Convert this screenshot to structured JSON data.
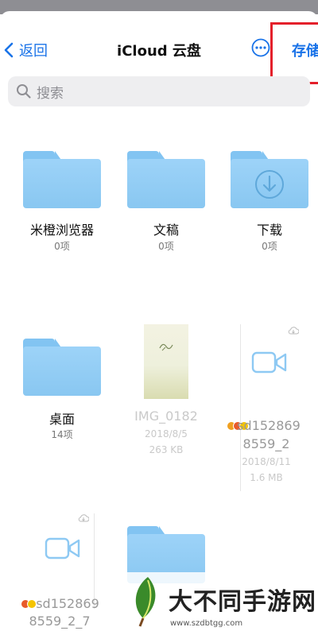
{
  "nav": {
    "back_label": "返回",
    "title": "iCloud 云盘",
    "more_icon": "ellipsis-circle-icon",
    "store_label": "存储"
  },
  "search": {
    "placeholder": "搜索",
    "icon": "magnifier-icon"
  },
  "items": [
    {
      "name": "米橙浏览器",
      "meta": "0项",
      "kind": "folder"
    },
    {
      "name": "文稿",
      "meta": "0项",
      "kind": "folder"
    },
    {
      "name": "下载",
      "meta": "0项",
      "kind": "folder-download"
    },
    {
      "name": "桌面",
      "meta": "14项",
      "kind": "folder"
    },
    {
      "name": "IMG_0182",
      "date": "2018/8/5",
      "size": "263 KB",
      "kind": "image"
    },
    {
      "name_line1": "sd152869",
      "name_line2": "8559_2",
      "date": "2018/8/11",
      "size": "1.6 MB",
      "kind": "video"
    },
    {
      "name_line1": "sd152869",
      "name_line2": "8559_2_7",
      "kind": "video"
    },
    {
      "name": "",
      "kind": "folder"
    }
  ],
  "colors": {
    "accent": "#1a73e8",
    "folder": "#8ec9f3",
    "highlight": "#e4202b"
  },
  "watermark": {
    "text": "大不同手游网",
    "url": "www.szdbtgg.com"
  }
}
